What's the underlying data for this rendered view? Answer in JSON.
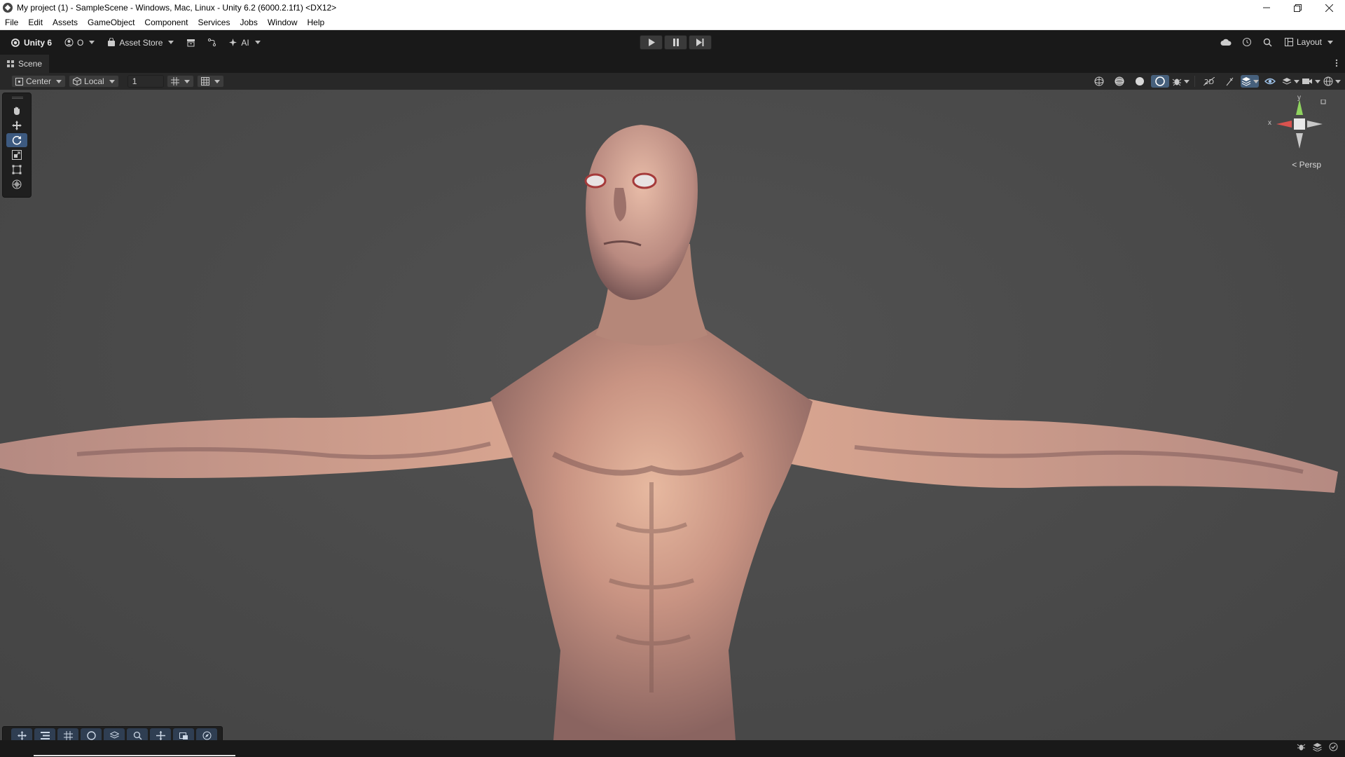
{
  "window": {
    "title": "My project (1) - SampleScene - Windows, Mac, Linux - Unity 6.2 (6000.2.1f1) <DX12>",
    "controls": [
      "minimize-icon",
      "restore-icon",
      "close-icon"
    ]
  },
  "menubar": {
    "items": [
      "File",
      "Edit",
      "Assets",
      "GameObject",
      "Component",
      "Services",
      "Jobs",
      "Window",
      "Help"
    ]
  },
  "toolbar": {
    "unity_label": "Unity 6",
    "account_label": "O",
    "asset_store_label": "Asset Store",
    "ai_label": "AI",
    "layout_label": "Layout"
  },
  "scene_tab": {
    "label": "Scene"
  },
  "scene_toolbar": {
    "pivot_label": "Center",
    "space_label": "Local",
    "snap_value": "1"
  },
  "viewport": {
    "gizmo_x": "x",
    "gizmo_y": "y",
    "persp_label": "< Persp",
    "background_color": "#4a4a4a",
    "active_tool": "rotate"
  },
  "colors": {
    "accent": "#46607c",
    "toolbar_bg": "#191919",
    "panel_bg": "#282828"
  }
}
